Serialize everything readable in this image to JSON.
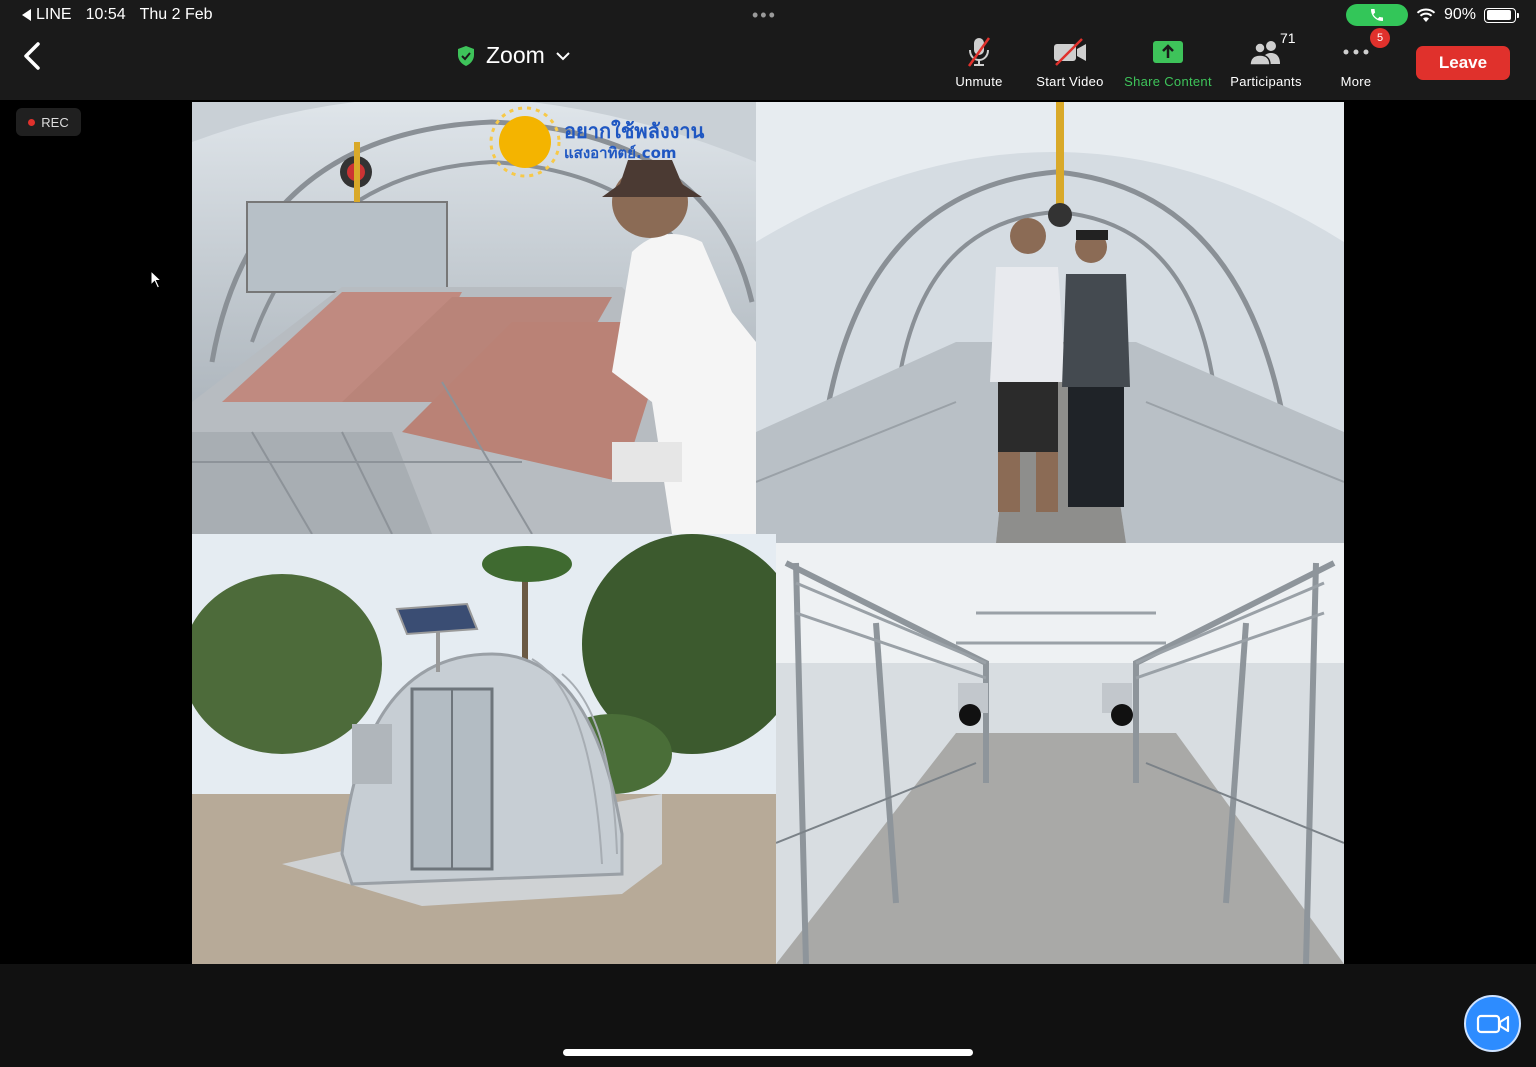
{
  "status_bar": {
    "back_app": "LINE",
    "time": "10:54",
    "date": "Thu 2 Feb",
    "battery": "90%",
    "battery_level": 0.9
  },
  "toolbar": {
    "meeting_title": "Zoom",
    "unmute_label": "Unmute",
    "start_video_label": "Start Video",
    "share_content_label": "Share Content",
    "participants_label": "Participants",
    "participants_count": "71",
    "more_label": "More",
    "more_badge": "5",
    "leave_label": "Leave"
  },
  "recording": {
    "label": "REC"
  },
  "shared_content": {
    "watermark_line1": "อยากใช้พลังงาน",
    "watermark_line2": "แสงอาทิตย์.com"
  },
  "colors": {
    "accent_green": "#3ec35a",
    "leave_red": "#e0312c",
    "fab_blue": "#2d8cff"
  }
}
